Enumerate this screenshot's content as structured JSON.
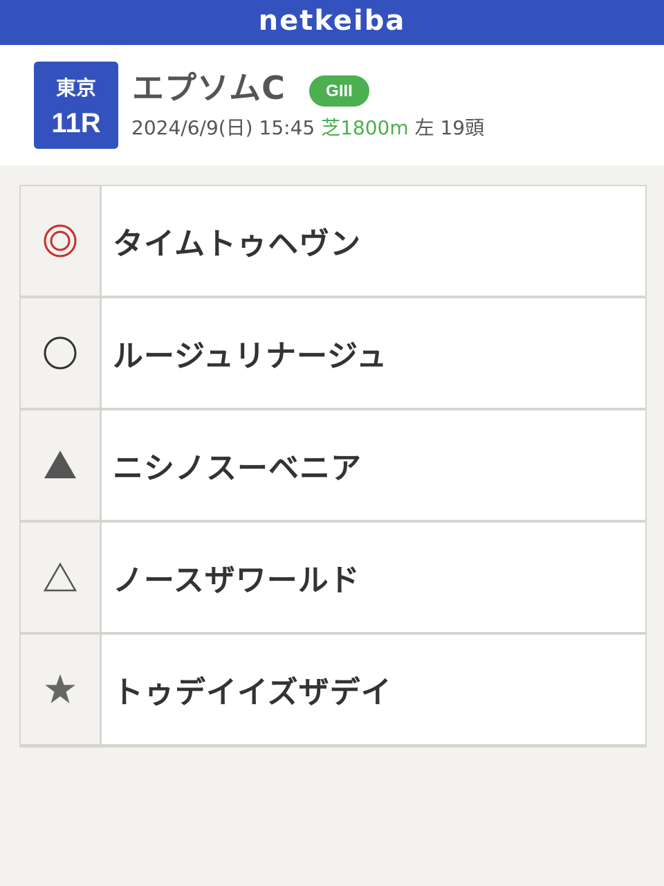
{
  "app": {
    "logo": "netkeiba"
  },
  "race": {
    "venue": "東京",
    "number": "11R",
    "name": "エプソムC",
    "grade": "GIII",
    "datetime": "2024/6/9(日) 15:45",
    "course": "芝1800m",
    "direction": "左",
    "runners": "19頭"
  },
  "colors": {
    "brand": "#3452bd",
    "grade": "#4caf50",
    "course": "#4caf50",
    "honmei_mark": "#c9302c"
  },
  "picks": [
    {
      "mark_icon": "double-circle-icon",
      "name": "タイムトゥヘヴン"
    },
    {
      "mark_icon": "circle-icon",
      "name": "ルージュリナージュ"
    },
    {
      "mark_icon": "filled-triangle-icon",
      "name": "ニシノスーベニア"
    },
    {
      "mark_icon": "outline-triangle-icon",
      "name": "ノースザワールド"
    },
    {
      "mark_icon": "star-icon",
      "name": "トゥデイイズザデイ"
    }
  ]
}
